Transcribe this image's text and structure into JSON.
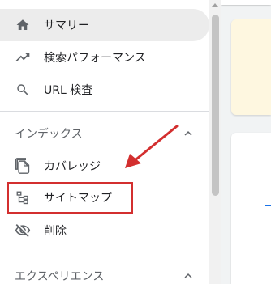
{
  "nav": {
    "summary": {
      "label": "サマリー",
      "icon": "home-icon"
    },
    "performance": {
      "label": "検索パフォーマンス",
      "icon": "trending-up-icon"
    },
    "url_inspection": {
      "label": "URL 検査",
      "icon": "search-icon"
    }
  },
  "index_section": {
    "title": "インデックス",
    "items": {
      "coverage": {
        "label": "カバレッジ",
        "icon": "file-copy-icon"
      },
      "sitemaps": {
        "label": "サイトマップ",
        "icon": "sitemap-icon"
      },
      "removals": {
        "label": "削除",
        "icon": "visibility-off-icon"
      }
    }
  },
  "experience_section": {
    "title": "エクスペリエンス"
  },
  "colors": {
    "accent_red": "#d32f2f",
    "active_bg": "#ececec",
    "main_bg": "#f1f3f4",
    "yellow_card": "#fef7e0",
    "blue": "#1a73e8"
  }
}
